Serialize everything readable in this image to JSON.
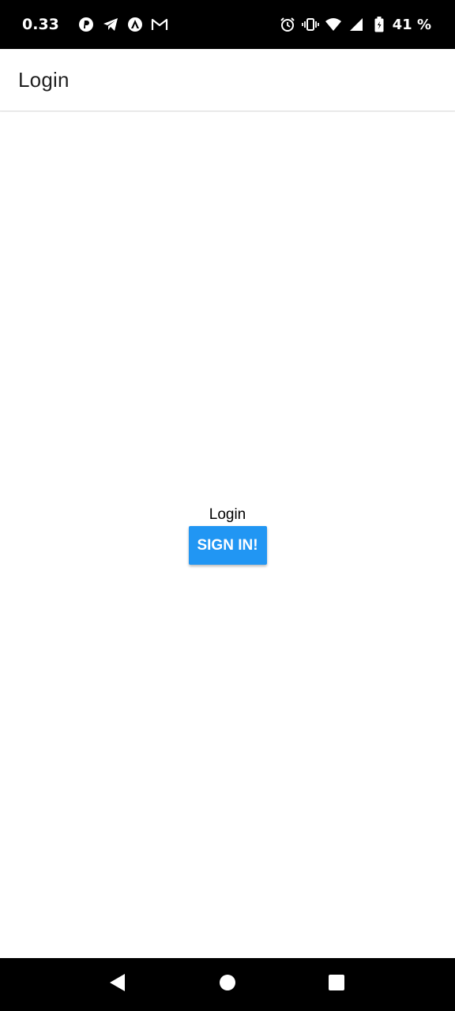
{
  "status_bar": {
    "time": "0.33",
    "battery_percent": "41 %",
    "left_icons": [
      "pinterest-icon",
      "telegram-icon",
      "artstudio-icon",
      "gmail-icon"
    ],
    "right_icons": [
      "alarm-icon",
      "vibrate-icon",
      "wifi-icon",
      "signal-icon",
      "battery-icon"
    ]
  },
  "app_bar": {
    "title": "Login"
  },
  "main": {
    "label": "Login",
    "sign_in_button": "SIGN IN!"
  },
  "nav_bar": {
    "buttons": [
      "back-icon",
      "home-icon",
      "recents-icon"
    ]
  },
  "colors": {
    "accent": "#2196f3",
    "status_bar": "#000000",
    "background": "#ffffff"
  }
}
